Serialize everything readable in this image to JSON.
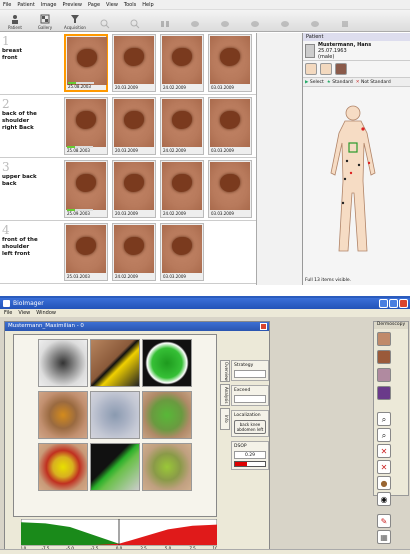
{
  "app1": {
    "menu": [
      "File",
      "Patient",
      "Image",
      "Preview",
      "Page",
      "View",
      "Tools",
      "Help"
    ],
    "toolbar": [
      {
        "label": "Patient",
        "icon": "patient-icon"
      },
      {
        "label": "Gallery",
        "icon": "gallery-icon"
      },
      {
        "label": "Acquisition",
        "icon": "acquisition-icon"
      }
    ],
    "rows": [
      {
        "num": "1",
        "label": "breast\nfront",
        "dates": [
          "25.08.2003",
          "20.03.2009",
          "24.02.2009",
          "03.03.2009"
        ]
      },
      {
        "num": "2",
        "label": "back of the shoulder\nright Back",
        "dates": [
          "25.08.2003",
          "20.03.2009",
          "24.02.2009",
          "03.03.2009"
        ]
      },
      {
        "num": "3",
        "label": "upper back\nback",
        "dates": [
          "25.09.2003",
          "20.03.2009",
          "24.02.2009",
          "03.03.2009"
        ]
      },
      {
        "num": "4",
        "label": "front of the shoulder\nleft front",
        "dates": [
          "25.03.2003",
          "24.02.2009",
          "03.03.2009"
        ]
      }
    ],
    "panel": {
      "title": "Patient",
      "patient_name": "Mustermann, Hans",
      "patient_sub": "25.07.1963",
      "patient_sex": "(male)",
      "select_label": "Select",
      "standard_label": "Standard",
      "not_standard_label": "Not Standard",
      "status": "Full  13 items visible."
    }
  },
  "app2": {
    "title": "BioImager",
    "menu": [
      "File",
      "View",
      "Window"
    ],
    "inner_title": "Mustermann_Maximilian - 0",
    "tabs": [
      "Overview",
      "Analysis",
      "Info"
    ],
    "side": {
      "strategy_label": "Strategy",
      "exceed_label": "Exceed",
      "localization_label": "Localization",
      "localization_btn": "back knee\nabdomen left",
      "score_label": "DSOP",
      "score_value": "0.29"
    },
    "right_title": "Dermoscopy"
  },
  "chart_data": {
    "type": "area",
    "x": [
      -10,
      -7.5,
      -5,
      -2.5,
      0,
      2.5,
      5,
      7.5,
      10
    ],
    "series": [
      {
        "values": [
          0.95,
          0.9,
          0.75,
          0.4,
          0.05,
          0,
          0,
          0,
          0
        ]
      },
      {
        "values": [
          0,
          0,
          0,
          0,
          0.05,
          0.35,
          0.65,
          0.8,
          0.85
        ]
      }
    ],
    "colors": [
      "#1a8a1a",
      "#e01a1a"
    ],
    "marker_x": 0
  }
}
